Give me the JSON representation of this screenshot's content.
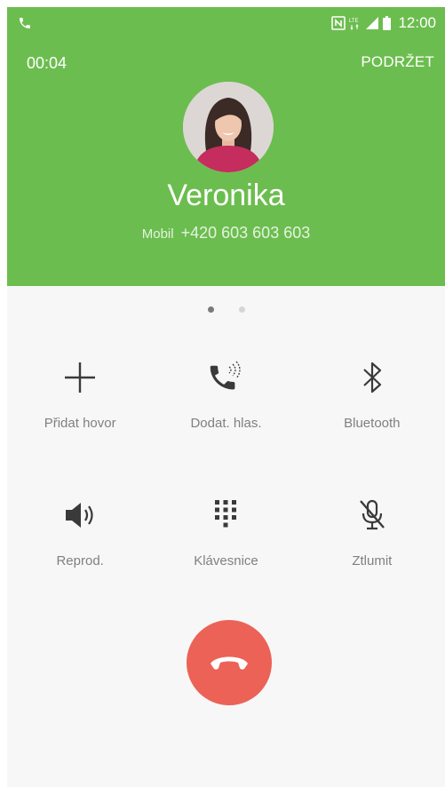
{
  "status_bar": {
    "left_icon": "phone-icon",
    "icons": [
      "nfc-icon",
      "lte-icon",
      "signal-icon",
      "battery-icon"
    ],
    "lte_label": "LTE",
    "time": "12:00"
  },
  "call": {
    "timer": "00:04",
    "hold_label": "PODRŽET",
    "contact_name": "Veronika",
    "number_type": "Mobil",
    "number": "+420 603 603 603"
  },
  "pager": {
    "pages": 2,
    "active": 0
  },
  "actions": [
    {
      "label": "Přidat hovor",
      "icon": "plus-icon"
    },
    {
      "label": "Dodat. hlas.",
      "icon": "extra-volume-icon"
    },
    {
      "label": "Bluetooth",
      "icon": "bluetooth-icon"
    },
    {
      "label": "Reprod.",
      "icon": "speaker-icon"
    },
    {
      "label": "Klávesnice",
      "icon": "keypad-icon"
    },
    {
      "label": "Ztlumit",
      "icon": "mute-icon"
    }
  ],
  "end_call": {
    "icon": "end-call-icon"
  },
  "colors": {
    "header_green": "#6cbd4f",
    "end_call_red": "#ec6256",
    "label_gray": "#808080",
    "icon_dark": "#3a3a3a"
  }
}
